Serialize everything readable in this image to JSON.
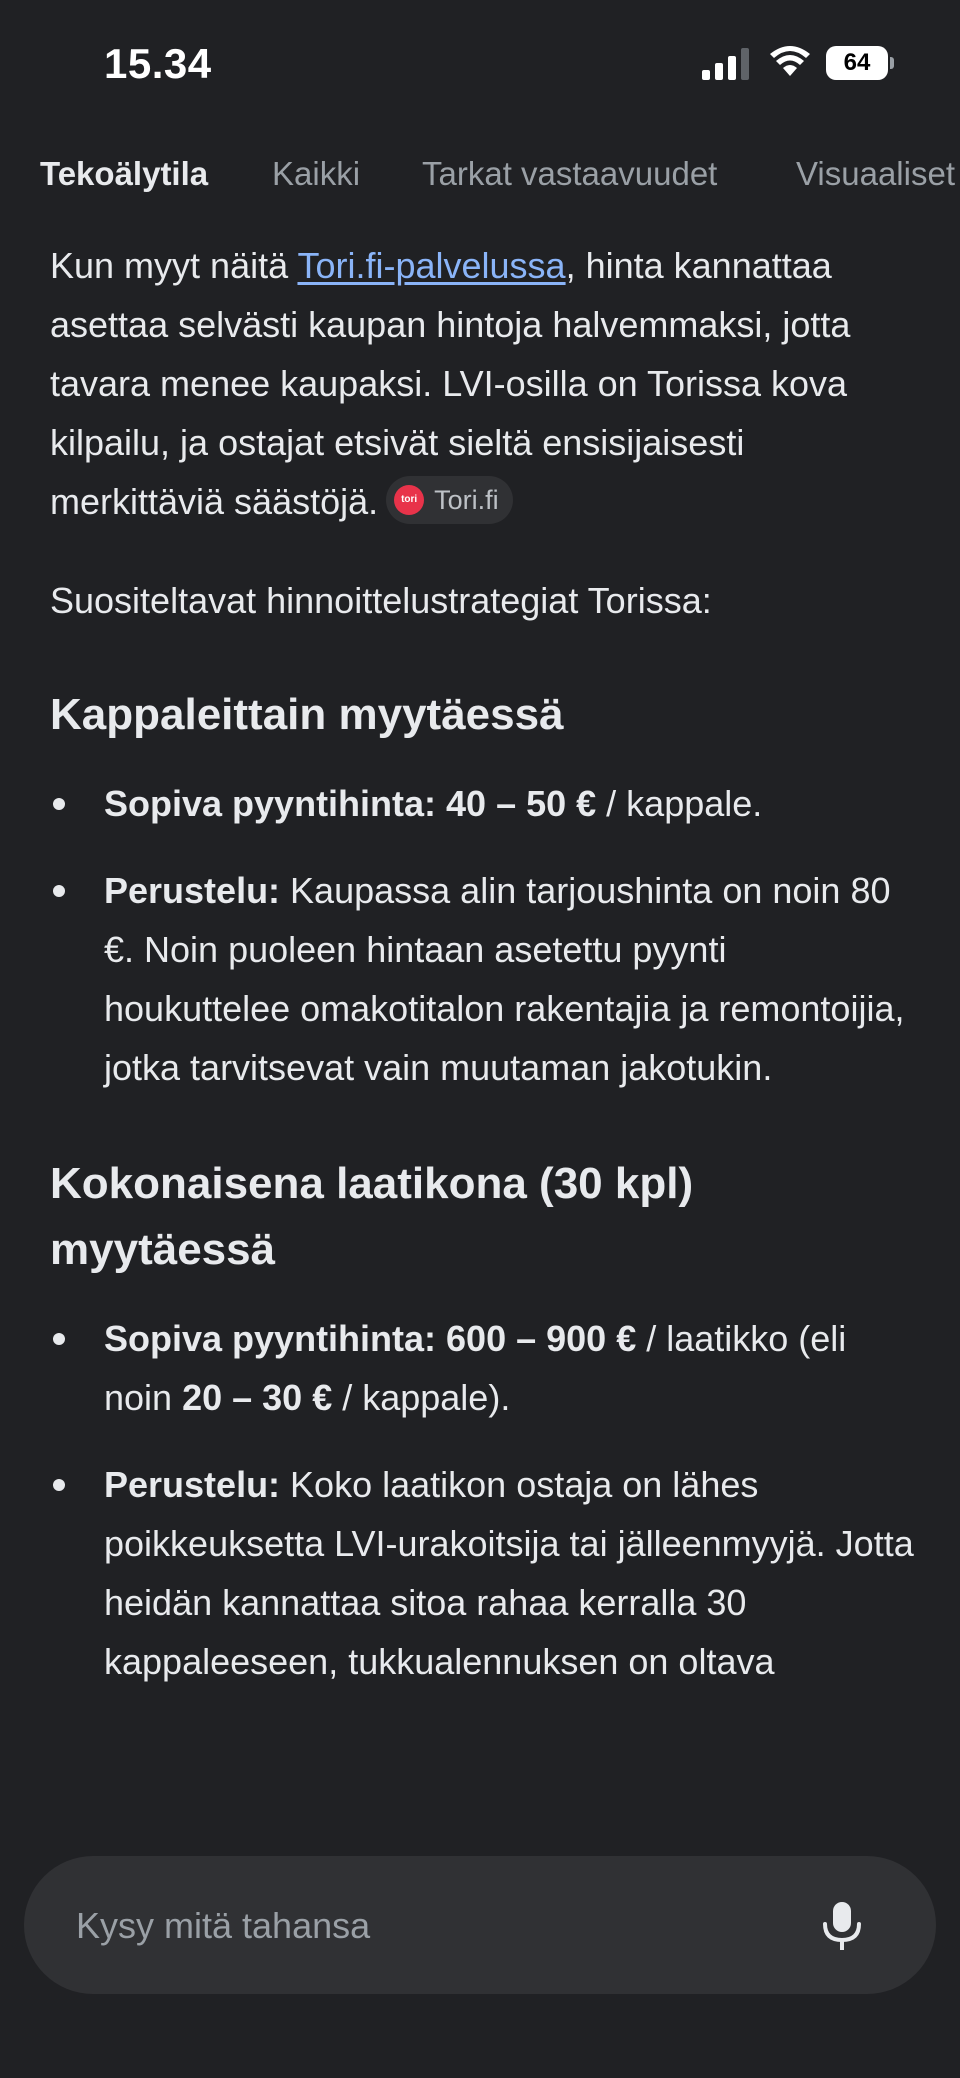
{
  "status_bar": {
    "time": "15.34",
    "battery": "64"
  },
  "tabs": [
    {
      "label": "Tekoälytila",
      "active": true
    },
    {
      "label": "Kaikki",
      "active": false
    },
    {
      "label": "Tarkat vastaavuudet",
      "active": false
    },
    {
      "label": "Visuaaliset",
      "active": false
    }
  ],
  "intro": {
    "text_before": "Kun myyt näitä ",
    "link": "Tori.fi-palvelussa",
    "text_after": ", hinta kannattaa asettaa selvästi kaupan hintoja halvemmaksi, jotta tavara menee kaupaksi. LVI-osilla on Torissa kova kilpailu, ja ostajat etsivät sieltä ensisijaisesti merkittäviä säästöjä.",
    "source_chip": {
      "logo_text": "tori",
      "label": "Tori.fi"
    }
  },
  "strategies_intro": "Suositeltavat hinnoittelustrategiat Torissa:",
  "sections": [
    {
      "heading": "Kappaleittain myytäessä",
      "bullets": [
        {
          "bold": "Sopiva pyyntihinta: 40 – 50 €",
          "text": " / kappale."
        },
        {
          "bold": "Perustelu:",
          "text": " Kaupassa alin tarjoushinta on noin 80 €. Noin puoleen hintaan asetettu pyynti houkuttelee omakotitalon rakentajia ja remontoijia, jotka tarvitsevat vain muutaman jakotukin."
        }
      ]
    },
    {
      "heading": "Kokonaisena laatikona (30 kpl) myytäessä",
      "bullets": [
        {
          "bold": "Sopiva pyyntihinta: 600 – 900 €",
          "text": " / laatikko (eli noin ",
          "bold2": "20 – 30 €",
          "text2": " / kappale)."
        },
        {
          "bold": "Perustelu:",
          "text": " Koko laatikon ostaja on lähes poikkeuksetta LVI-urakoitsija tai jälleenmyyjä. Jotta heidän kannattaa sitoa rahaa kerralla 30 kappaleeseen, tukkualennuksen on oltava"
        }
      ]
    }
  ],
  "ask_bar": {
    "placeholder": "Kysy mitä tahansa"
  }
}
